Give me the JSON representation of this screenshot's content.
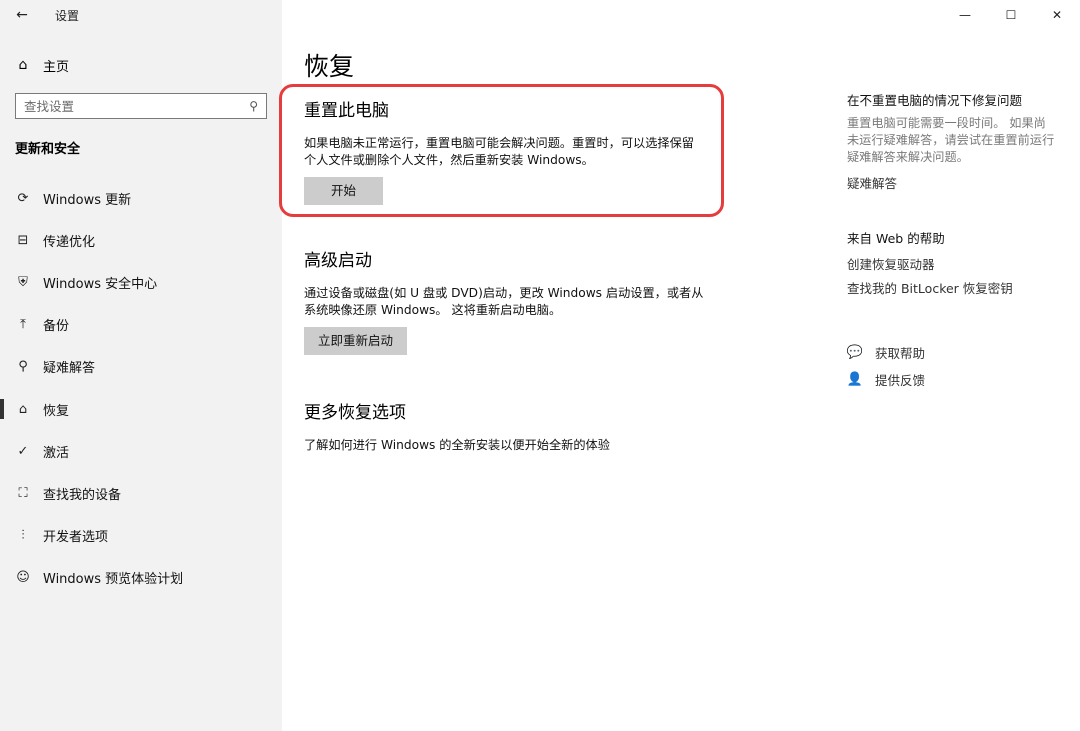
{
  "window": {
    "app_title": "设置",
    "back_icon": "arrow-left-icon",
    "minimize": "—",
    "maximize": "☐",
    "close": "✕"
  },
  "sidebar": {
    "home_label": "主页",
    "search_placeholder": "查找设置",
    "section_heading": "更新和安全",
    "items": [
      {
        "label": "Windows 更新",
        "icon": "refresh-icon",
        "glyph": "⟳"
      },
      {
        "label": "传递优化",
        "icon": "delivery-optimization-icon",
        "glyph": "⊟"
      },
      {
        "label": "Windows 安全中心",
        "icon": "shield-icon",
        "glyph": "⛨"
      },
      {
        "label": "备份",
        "icon": "backup-arrow-icon",
        "glyph": "⤒"
      },
      {
        "label": "疑难解答",
        "icon": "wrench-icon",
        "glyph": "⚲"
      },
      {
        "label": "恢复",
        "icon": "recovery-icon",
        "glyph": "⌂"
      },
      {
        "label": "激活",
        "icon": "check-circle-icon",
        "glyph": "✓"
      },
      {
        "label": "查找我的设备",
        "icon": "person-location-icon",
        "glyph": "⛶"
      },
      {
        "label": "开发者选项",
        "icon": "developer-icon",
        "glyph": "⫶"
      },
      {
        "label": "Windows 预览体验计划",
        "icon": "insider-icon",
        "glyph": "☺"
      }
    ],
    "selected_index": 5
  },
  "main": {
    "title": "恢复",
    "reset": {
      "heading": "重置此电脑",
      "desc_line1": "如果电脑未正常运行，重置电脑可能会解决问题。重置时，可以选择保留",
      "desc_line2": "个人文件或删除个人文件，然后重新安装 Windows。",
      "button": "开始"
    },
    "advanced": {
      "heading": "高级启动",
      "desc_line1": "通过设备或磁盘(如 U 盘或 DVD)启动，更改 Windows 启动设置，或者从",
      "desc_line2": "系统映像还原 Windows。 这将重新启动电脑。",
      "button": "立即重新启动"
    },
    "more": {
      "heading": "更多恢复选项",
      "link": "了解如何进行 Windows 的全新安装以便开始全新的体验"
    }
  },
  "right_panel": {
    "fix": {
      "heading": "在不重置电脑的情况下修复问题",
      "desc_line1": "重置电脑可能需要一段时间。 如果尚",
      "desc_line2": "未运行疑难解答，请尝试在重置前运行",
      "desc_line3": "疑难解答来解决问题。",
      "link": "疑难解答"
    },
    "web_help": {
      "heading": "来自 Web 的帮助",
      "link1": "创建恢复驱动器",
      "link2": "查找我的 BitLocker 恢复密钥"
    },
    "get_help": "获取帮助",
    "feedback": "提供反馈"
  },
  "colors": {
    "sidebar_bg": "#f2f2f2",
    "button_bg": "#cccccc",
    "highlight": "#e53d3d"
  }
}
